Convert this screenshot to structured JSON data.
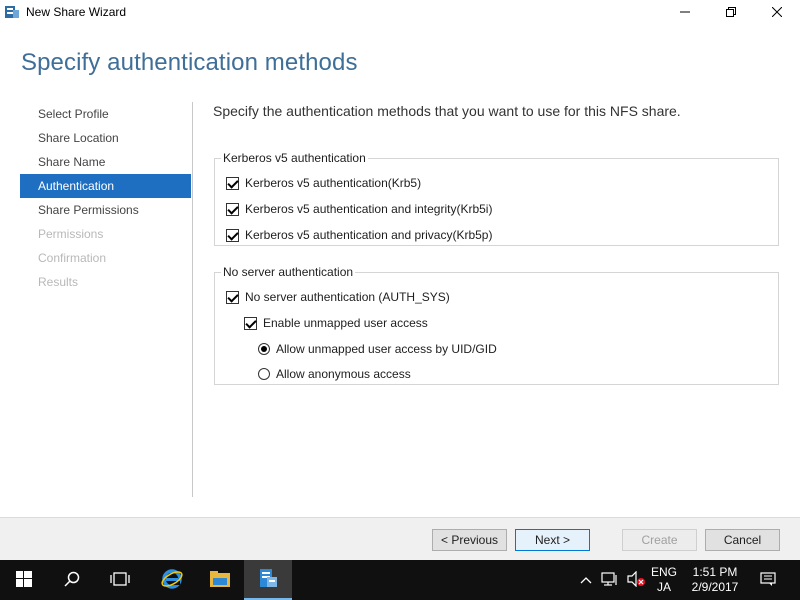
{
  "window": {
    "title": "New Share Wizard",
    "minimize_icon": "minimize-icon",
    "maximize_icon": "maximize-icon",
    "close_icon": "close-icon"
  },
  "page_title": "Specify authentication methods",
  "nav": [
    {
      "label": "Select Profile",
      "state": "normal"
    },
    {
      "label": "Share Location",
      "state": "normal"
    },
    {
      "label": "Share Name",
      "state": "normal"
    },
    {
      "label": "Authentication",
      "state": "selected"
    },
    {
      "label": "Share Permissions",
      "state": "normal"
    },
    {
      "label": "Permissions",
      "state": "disabled"
    },
    {
      "label": "Confirmation",
      "state": "disabled"
    },
    {
      "label": "Results",
      "state": "disabled"
    }
  ],
  "description": "Specify the authentication methods that you want to use for this NFS share.",
  "kerberos_group": {
    "legend": "Kerberos v5 authentication",
    "options": [
      {
        "label": "Kerberos v5 authentication(Krb5)",
        "checked": true
      },
      {
        "label": "Kerberos v5 authentication and integrity(Krb5i)",
        "checked": true
      },
      {
        "label": "Kerberos v5 authentication and privacy(Krb5p)",
        "checked": true
      }
    ]
  },
  "noserver_group": {
    "legend": "No server authentication",
    "auth_sys": {
      "label": "No server authentication (AUTH_SYS)",
      "checked": true
    },
    "unmapped": {
      "label": "Enable unmapped user access",
      "checked": true
    },
    "radio_uid": {
      "label": "Allow unmapped user access by UID/GID",
      "selected": true
    },
    "radio_anon": {
      "label": "Allow anonymous access",
      "selected": false
    }
  },
  "buttons": {
    "previous": "< Previous",
    "next": "Next >",
    "create": "Create",
    "cancel": "Cancel"
  },
  "taskbar": {
    "lang_top": "ENG",
    "lang_bottom": "JA",
    "time": "1:51 PM",
    "date": "2/9/2017"
  },
  "colors": {
    "accent": "#1e6fc2",
    "title": "#3f6f98",
    "taskbar": "#101010"
  }
}
